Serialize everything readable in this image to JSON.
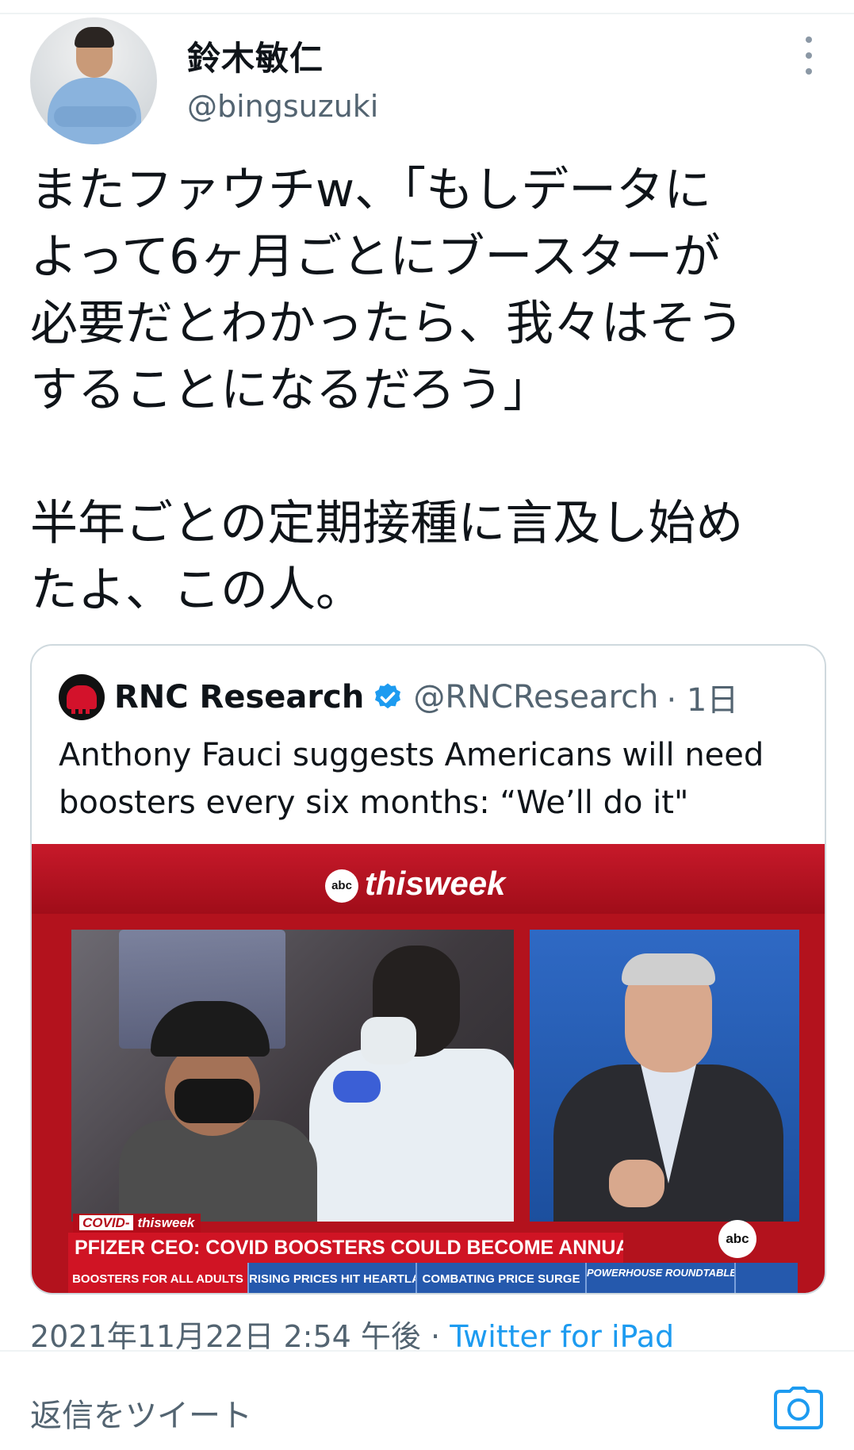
{
  "author": {
    "name": "鈴木敏仁",
    "handle": "@bingsuzuki"
  },
  "tweet": {
    "lines": [
      "またファウチw、「もしデータに",
      "よって6ヶ月ごとにブースターが",
      "必要だとわかったら、我々はそう",
      "することになるだろう」",
      "",
      "半年ごとの定期接種に言及し始め",
      "たよ、この人。"
    ]
  },
  "quote": {
    "name": "RNC Research",
    "handle": "@RNCResearch",
    "time": "· 1日",
    "text": "Anthony Fauci suggests Americans will need boosters every six months: “We’ll do it\""
  },
  "video": {
    "network": "abc",
    "show": "thisweek",
    "tag_key": "COVID-",
    "tag_show": "thisweek",
    "headline": "PFIZER CEO: COVID BOOSTERS COULD BECOME ANNUAL",
    "lower_third": [
      "BOOSTERS FOR ALL ADULTS",
      "RISING PRICES HIT HEARTLAND",
      "COMBATING PRICE SURGE",
      "POWERHOUSE ROUNDTABLE"
    ]
  },
  "meta": {
    "timestamp": "2021年11月22日 2:54 午後",
    "separator": "·",
    "source": "Twitter for iPad"
  },
  "reply": {
    "placeholder": "返信をツイート"
  },
  "colors": {
    "link": "#1d9bf0",
    "secondary_text": "#536471",
    "verified": "#1d9bf0"
  },
  "icons": [
    "more-icon",
    "verified-icon",
    "camera-icon"
  ]
}
